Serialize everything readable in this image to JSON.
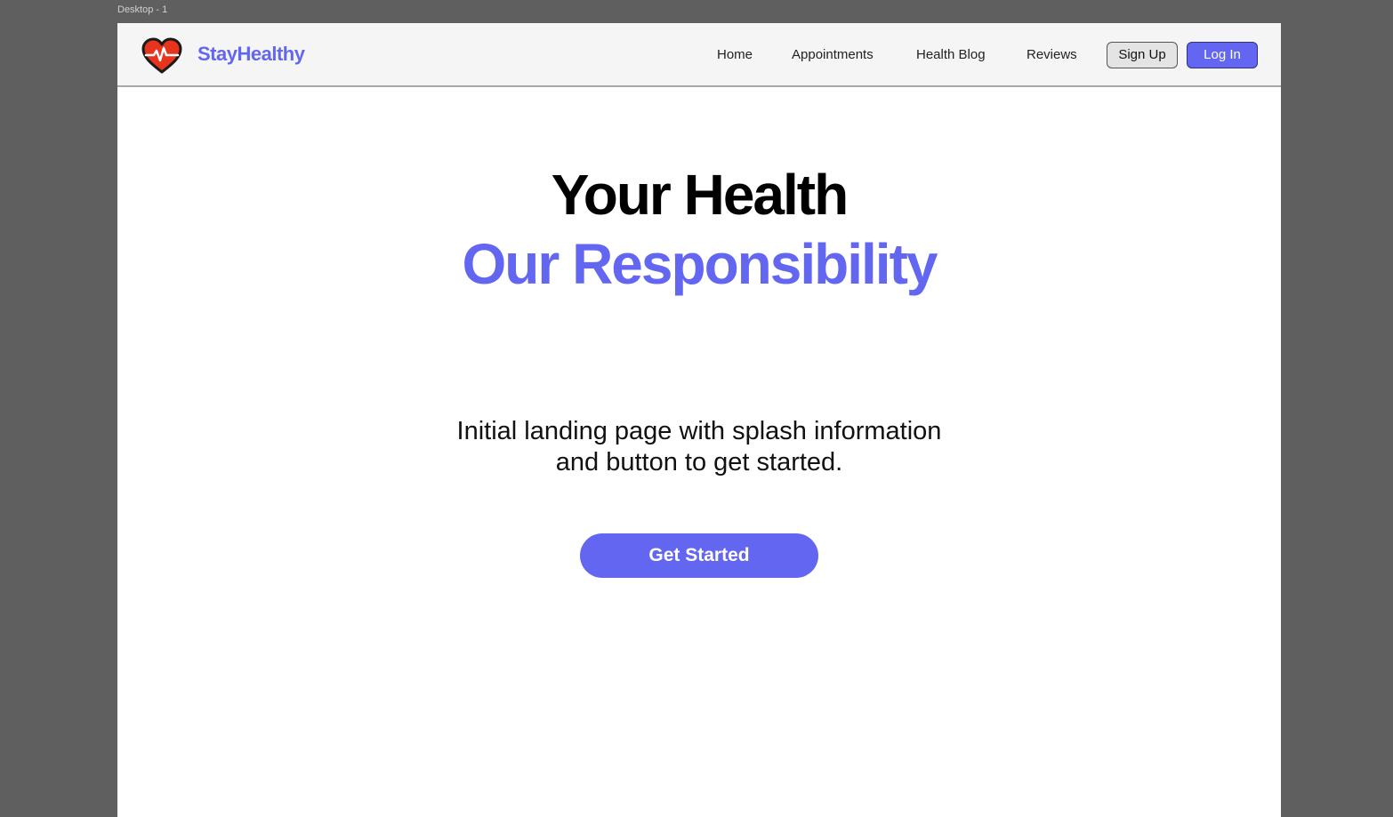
{
  "canvas": {
    "label": "Desktop - 1"
  },
  "header": {
    "brand": "StayHealthy",
    "logo_icon": "heart-pulse-icon",
    "nav": [
      "Home",
      "Appointments",
      "Health Blog",
      "Reviews"
    ],
    "signup_label": "Sign Up",
    "login_label": "Log In"
  },
  "hero": {
    "title_line1": "Your Health",
    "title_line2": "Our Responsibility",
    "description_line1": "Initial landing page with splash information",
    "description_line2": "and button to get started.",
    "cta_label": "Get Started"
  },
  "colors": {
    "accent": "#6366f1",
    "heart": "#e8331d",
    "canvas_bg": "#5f5f5f",
    "navbar_bg": "#f5f5f5"
  }
}
